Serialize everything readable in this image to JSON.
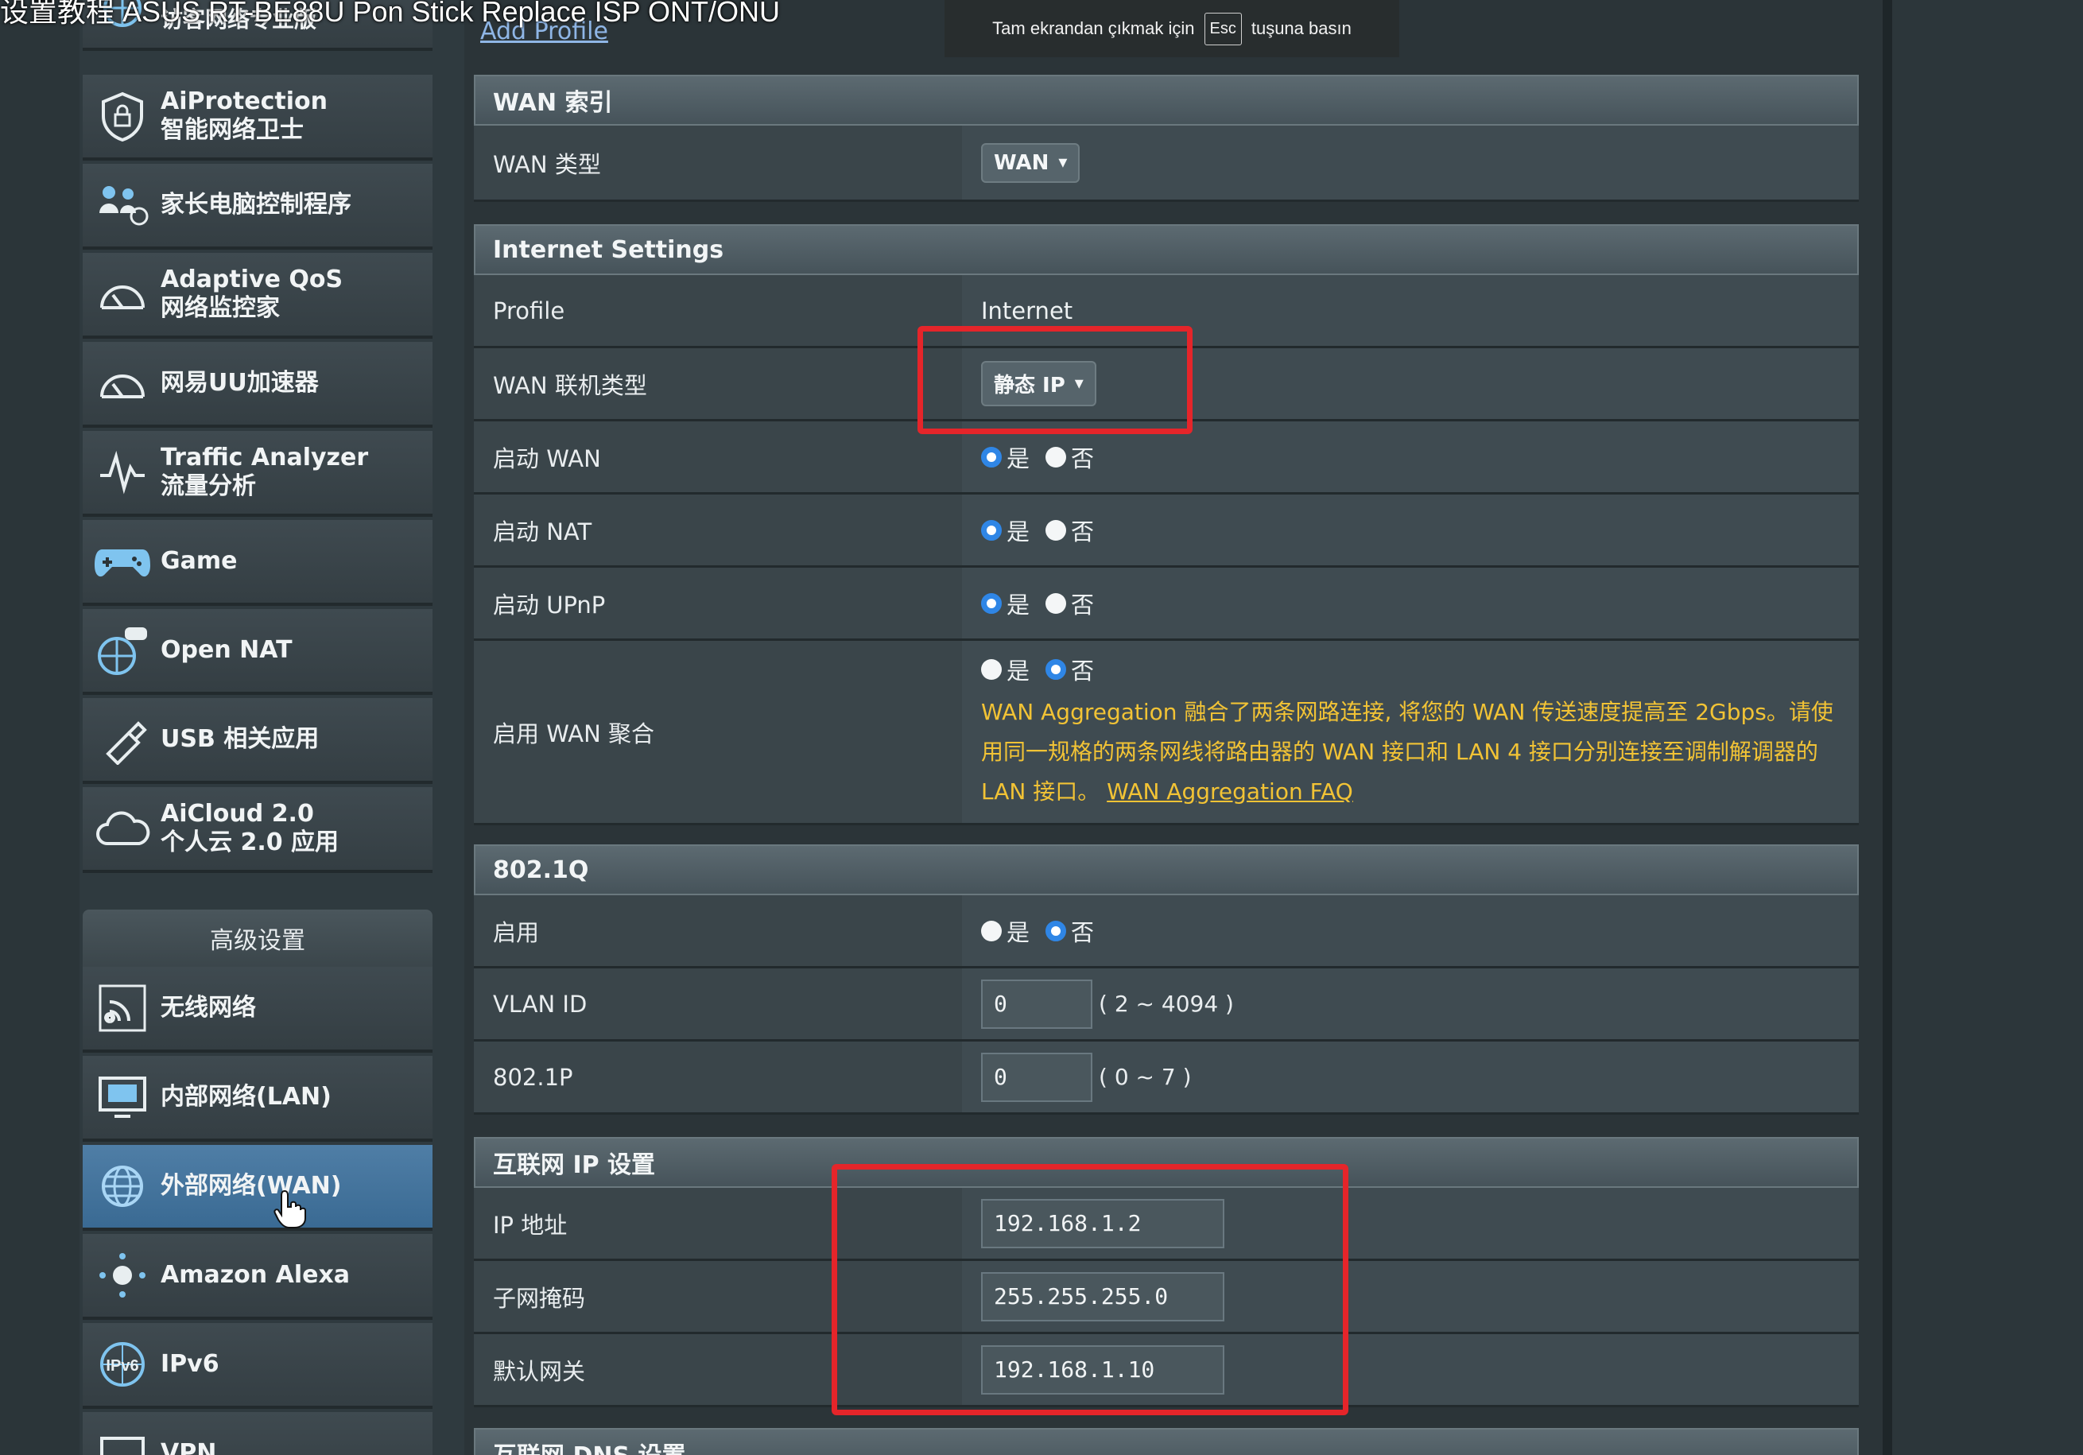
{
  "overlay": {
    "video_title": "设置教程 ASUS RT-BE88U Pon Stick Replace ISP ONT/ONU",
    "fullscreen_prefix": "Tam ekrandan çıkmak için",
    "fullscreen_key": "Esc",
    "fullscreen_suffix": "tuşuna basın"
  },
  "sidebar": {
    "top_item": "访客网络专业版",
    "items": [
      {
        "l1": "AiProtection",
        "l2": "智能网络卫士",
        "icon": "shield-lock-icon"
      },
      {
        "l1": "家长电脑控制程序",
        "l2": "",
        "icon": "family-icon"
      },
      {
        "l1": "Adaptive QoS",
        "l2": "网络监控家",
        "icon": "speedometer-icon"
      },
      {
        "l1": "网易UU加速器",
        "l2": "",
        "icon": "speedometer-icon"
      },
      {
        "l1": "Traffic Analyzer",
        "l2": "流量分析",
        "icon": "pulse-icon"
      },
      {
        "l1": "Game",
        "l2": "",
        "icon": "gamepad-icon"
      },
      {
        "l1": "Open NAT",
        "l2": "",
        "icon": "globe-gamepad-icon"
      },
      {
        "l1": "USB 相关应用",
        "l2": "",
        "icon": "usb-icon"
      },
      {
        "l1": "AiCloud 2.0",
        "l2": "个人云 2.0 应用",
        "icon": "cloud-icon"
      }
    ],
    "advanced_header": "高级设置",
    "advanced_items": [
      {
        "label": "无线网络",
        "icon": "wifi-icon"
      },
      {
        "label": "内部网络(LAN)",
        "icon": "monitor-icon"
      },
      {
        "label": "外部网络(WAN)",
        "icon": "globe-icon",
        "active": true
      },
      {
        "label": "Amazon Alexa",
        "icon": "alexa-icon"
      },
      {
        "label": "IPv6",
        "icon": "ipv6-icon"
      },
      {
        "label": "VPN",
        "icon": "vpn-icon"
      }
    ]
  },
  "main": {
    "add_profile": "Add Profile",
    "wan_index": {
      "title": "WAN 索引",
      "wan_type_label": "WAN 类型",
      "wan_type_value": "WAN"
    },
    "internet_settings": {
      "title": "Internet Settings",
      "profile_label": "Profile",
      "profile_value": "Internet",
      "conn_type_label": "WAN 联机类型",
      "conn_type_value": "静态 IP",
      "enable_wan_label": "启动 WAN",
      "enable_nat_label": "启动 NAT",
      "enable_upnp_label": "启动 UPnP",
      "wan_agg_label": "启用 WAN 聚合",
      "yes": "是",
      "no": "否",
      "wan_agg_note": "WAN Aggregation 融合了两条网路连接, 将您的 WAN 传送速度提高至 2Gbps。请使用同一规格的两条网线将路由器的 WAN 接口和 LAN 4 接口分别连接至调制解调器的 LAN 接口。",
      "wan_agg_link": "WAN Aggregation FAQ"
    },
    "dot1q": {
      "title": "802.1Q",
      "enable_label": "启用",
      "vlan_label": "VLAN ID",
      "vlan_value": "0",
      "vlan_range": "( 2 ~ 4094 )",
      "p_label": "802.1P",
      "p_value": "0",
      "p_range": "( 0 ~ 7 )"
    },
    "ip_settings": {
      "title": "互联网 IP 设置",
      "ip_label": "IP 地址",
      "ip_value": "192.168.1.2",
      "mask_label": "子网掩码",
      "mask_value": "255.255.255.0",
      "gw_label": "默认网关",
      "gw_value": "192.168.1.10"
    },
    "dns_title": "互联网 DNS 设置"
  },
  "colors": {
    "accent_blue": "#2f86e6",
    "highlight_red": "#e5252a",
    "note_yellow": "#f2c335"
  }
}
